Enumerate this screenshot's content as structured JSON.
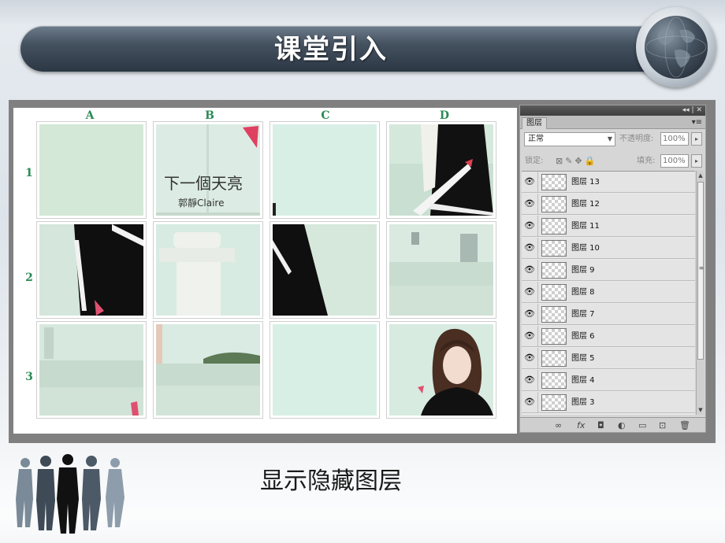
{
  "slide": {
    "title": "课堂引入",
    "caption": "显示隐藏图层"
  },
  "puzzle": {
    "columns": [
      "A",
      "B",
      "C",
      "D"
    ],
    "rows": [
      "1",
      "2",
      "3"
    ]
  },
  "layers_panel": {
    "tab_label": "图层",
    "topbar_controls": "◂◂ | ✕",
    "menu_icon": "▾≡",
    "blend_mode": "正常",
    "opacity_label": "不透明度:",
    "opacity_value": "100%",
    "lock_label": "锁定:",
    "fill_label": "填充:",
    "fill_value": "100%",
    "layers": [
      {
        "name": "图层 13",
        "visible": true
      },
      {
        "name": "图层 12",
        "visible": true
      },
      {
        "name": "图层 11",
        "visible": true
      },
      {
        "name": "图层 10",
        "visible": true
      },
      {
        "name": "图层 9",
        "visible": true
      },
      {
        "name": "图层 8",
        "visible": true
      },
      {
        "name": "图层 7",
        "visible": true
      },
      {
        "name": "图层 6",
        "visible": true
      },
      {
        "name": "图层 5",
        "visible": true
      },
      {
        "name": "图层 4",
        "visible": true
      },
      {
        "name": "图层 3",
        "visible": true
      }
    ],
    "bottom_icons": [
      "link-icon",
      "fx-icon",
      "mask-icon",
      "adjustment-icon",
      "group-icon",
      "new-layer-icon",
      "trash-icon"
    ]
  },
  "colors": {
    "title_bar": "#3a4654",
    "grid_label": "#2a8a55",
    "photo_bg": "#d6eadf"
  }
}
